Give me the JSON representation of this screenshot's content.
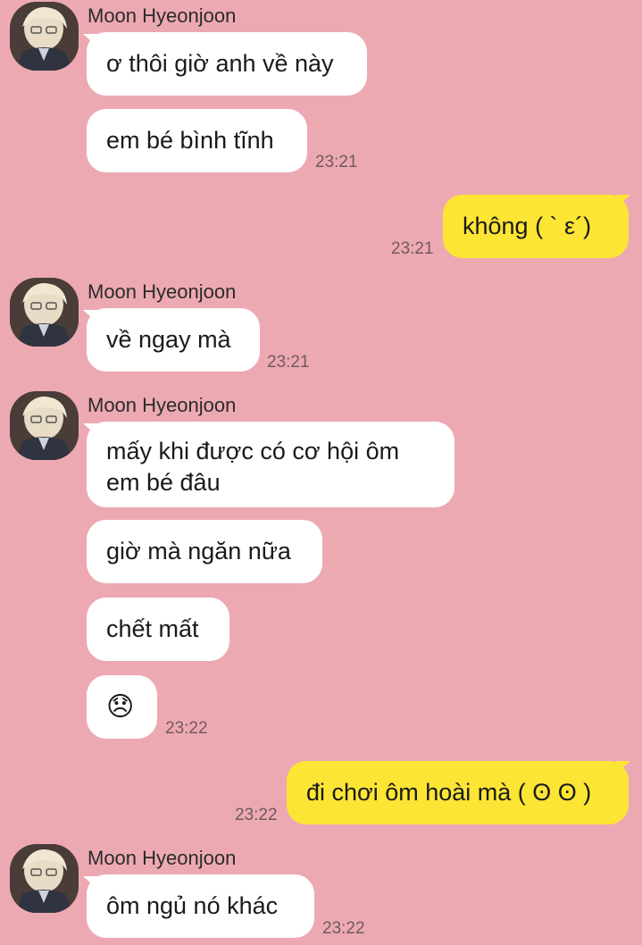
{
  "chat": {
    "sender_name": "Moon Hyeonjoon",
    "colors": {
      "background": "#EDA9B2",
      "incoming_bubble": "#ffffff",
      "outgoing_bubble": "#FCE534"
    },
    "messages": [
      {
        "from": "them",
        "text": "ơ thôi giờ anh về này",
        "time": ""
      },
      {
        "from": "them",
        "text": "em bé bình tĩnh",
        "time": "23:21"
      },
      {
        "from": "me",
        "text": "không ( ` ε´)",
        "time": "23:21"
      },
      {
        "from": "them",
        "text": "về ngay mà",
        "time": "23:21"
      },
      {
        "from": "them",
        "text": "mấy khi được có cơ hội ôm em bé đâu",
        "time": ""
      },
      {
        "from": "them",
        "text": "giờ mà ngăn nữa",
        "time": ""
      },
      {
        "from": "them",
        "text": "chết mất",
        "time": ""
      },
      {
        "from": "them",
        "text": "😞",
        "time": "23:22"
      },
      {
        "from": "me",
        "text": "đi chơi ôm hoài mà ( ʘ ʘ )",
        "time": "23:22"
      },
      {
        "from": "them",
        "text": "ôm ngủ nó khác",
        "time": "23:22"
      }
    ]
  }
}
